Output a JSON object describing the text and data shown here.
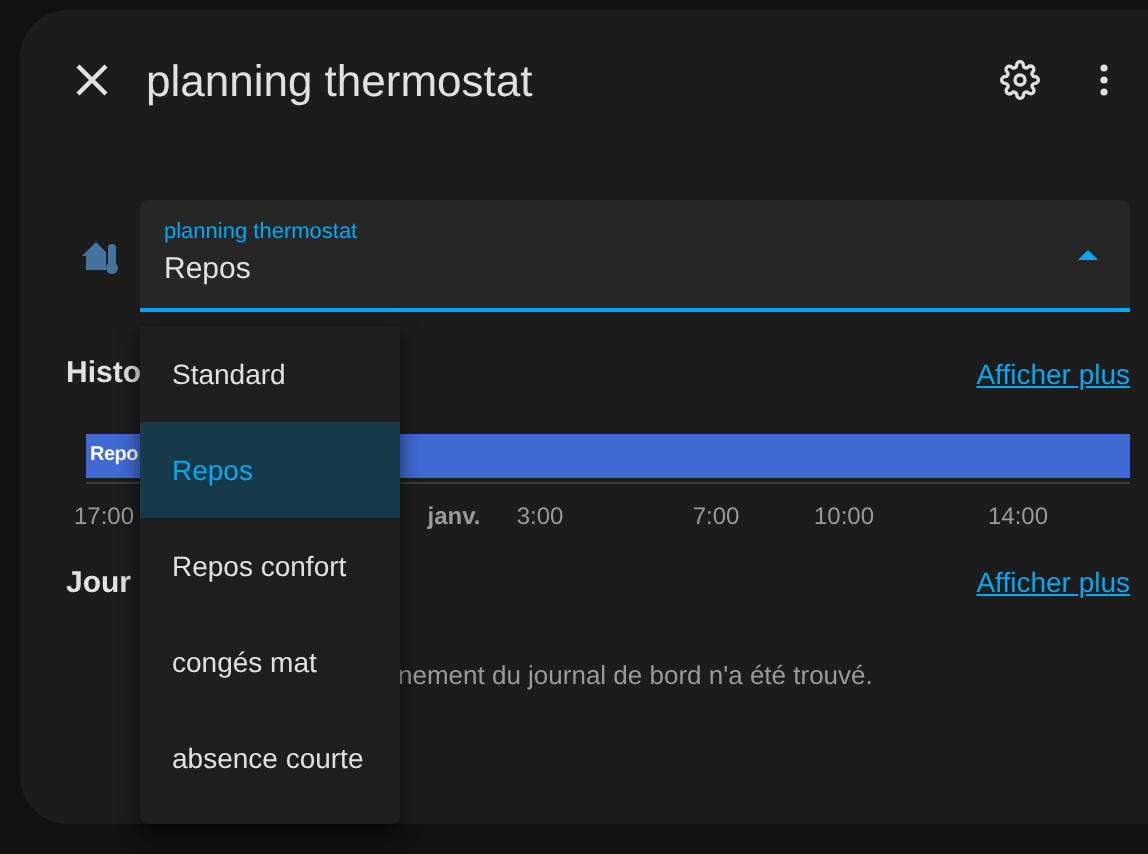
{
  "dialog": {
    "title": "planning thermostat"
  },
  "select": {
    "label": "planning thermostat",
    "value": "Repos",
    "expanded": true
  },
  "history": {
    "title": "Histo",
    "link": "Afficher plus",
    "bar_label": "Repo",
    "axis_labels": [
      {
        "text": "17:00",
        "bold": false
      },
      {
        "text": "janv.",
        "bold": true
      },
      {
        "text": "3:00",
        "bold": false
      },
      {
        "text": "7:00",
        "bold": false
      },
      {
        "text": "10:00",
        "bold": false
      },
      {
        "text": "14:00",
        "bold": false
      }
    ]
  },
  "logbook": {
    "title": "Jour",
    "link": "Afficher plus",
    "message": "nement du journal de bord n'a été trouvé."
  },
  "menu": {
    "items": [
      {
        "label": "Standard",
        "selected": false
      },
      {
        "label": "Repos",
        "selected": true
      },
      {
        "label": "Repos confort",
        "selected": false
      },
      {
        "label": "congés mat",
        "selected": false
      },
      {
        "label": "absence courte",
        "selected": false
      }
    ]
  }
}
